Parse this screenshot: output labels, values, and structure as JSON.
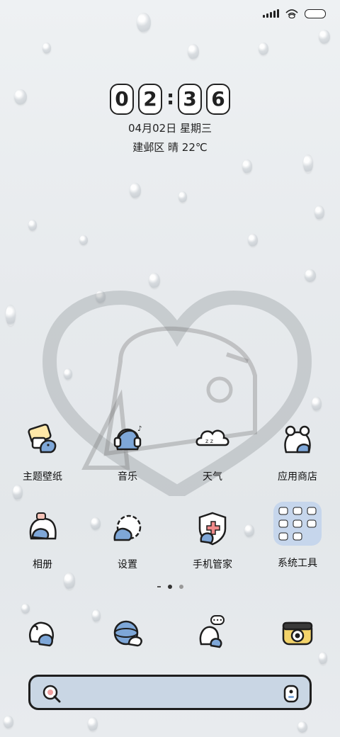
{
  "status_bar": {
    "signal_icon": "signal-bars-icon",
    "wifi_icon": "wifi-icon",
    "battery_icon": "battery-icon"
  },
  "clock": {
    "h1": "0",
    "h2": "2",
    "colon": ":",
    "m1": "3",
    "m2": "6",
    "date": "04月02日 星期三",
    "weather": "建邺区 晴 22℃"
  },
  "apps_row1": [
    {
      "label": "主题壁纸",
      "icon": "theme-wallpaper-icon"
    },
    {
      "label": "音乐",
      "icon": "music-icon"
    },
    {
      "label": "天气",
      "icon": "weather-icon"
    },
    {
      "label": "应用商店",
      "icon": "app-store-icon"
    }
  ],
  "apps_row2": [
    {
      "label": "相册",
      "icon": "gallery-icon"
    },
    {
      "label": "设置",
      "icon": "settings-icon"
    },
    {
      "label": "手机管家",
      "icon": "phone-manager-icon"
    },
    {
      "label": "系统工具",
      "icon": "system-tools-folder-icon"
    }
  ],
  "page_indicator": {
    "pages": 2,
    "current": 1
  },
  "dock": [
    "phone-icon",
    "browser-icon",
    "messages-icon",
    "camera-icon"
  ],
  "search_bar": {
    "search_icon": "search-icon",
    "assistant_icon": "assistant-icon"
  },
  "colors": {
    "accent_blue": "#7ea7d8",
    "outline": "#1e1e1e",
    "search_bg": "#c9d6e4"
  }
}
